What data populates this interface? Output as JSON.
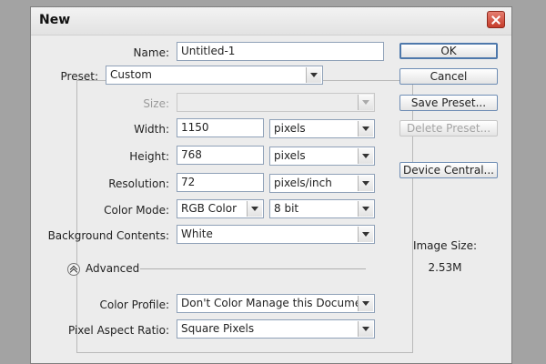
{
  "window": {
    "title": "New"
  },
  "fields": {
    "name": {
      "label": "Name:",
      "value": "Untitled-1"
    },
    "preset": {
      "label": "Preset:",
      "value": "Custom"
    },
    "size": {
      "label": "Size:",
      "value": ""
    },
    "width": {
      "label": "Width:",
      "value": "1150",
      "unit": "pixels"
    },
    "height": {
      "label": "Height:",
      "value": "768",
      "unit": "pixels"
    },
    "resolution": {
      "label": "Resolution:",
      "value": "72",
      "unit": "pixels/inch"
    },
    "color_mode": {
      "label": "Color Mode:",
      "value": "RGB Color",
      "depth": "8 bit"
    },
    "background": {
      "label": "Background Contents:",
      "value": "White"
    },
    "advanced": {
      "label": "Advanced"
    },
    "color_profile": {
      "label": "Color Profile:",
      "value": "Don't Color Manage this Document"
    },
    "pixel_aspect": {
      "label": "Pixel Aspect Ratio:",
      "value": "Square Pixels"
    }
  },
  "buttons": {
    "ok": "OK",
    "cancel": "Cancel",
    "save_preset": "Save Preset...",
    "delete_preset": "Delete Preset...",
    "device_central": "Device Central..."
  },
  "image_size": {
    "label": "Image Size:",
    "value": "2.53M"
  }
}
